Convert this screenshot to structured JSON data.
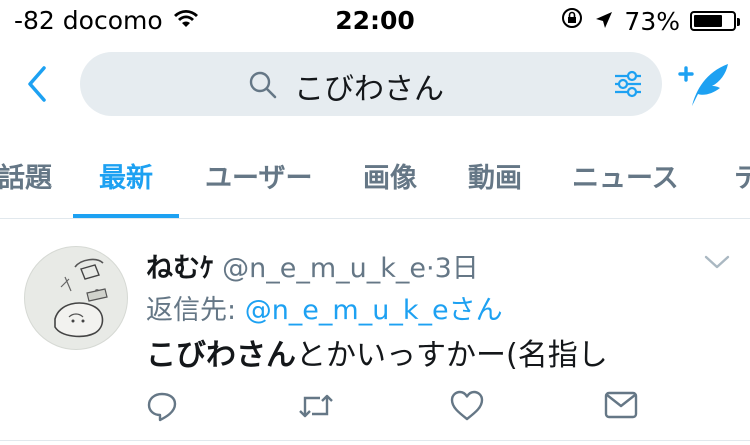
{
  "status_bar": {
    "carrier": "-82 docomo",
    "time": "22:00",
    "battery_percent": "73%",
    "battery_level": 0.73
  },
  "search": {
    "query": "こびわさん"
  },
  "tabs": [
    {
      "label": "話題"
    },
    {
      "label": "最新",
      "active": true
    },
    {
      "label": "ユーザー"
    },
    {
      "label": "画像"
    },
    {
      "label": "動画"
    },
    {
      "label": "ニュース"
    },
    {
      "label": "テ"
    }
  ],
  "tweet": {
    "display_name": "ねむｹ",
    "handle": "@n_e_m_u_k_e",
    "dot": "·",
    "time": "3日",
    "reply_prefix": "返信先: ",
    "reply_to": "@n_e_m_u_k_eさん",
    "body_bold": "こびわさん",
    "body_rest": "とかいっすかー(名指し"
  },
  "colors": {
    "accent": "#1da1f2",
    "muted": "#657786",
    "search_bg": "#e6ecf0",
    "divider": "#e1e8ed"
  },
  "icons": [
    "wifi-icon",
    "rotation-lock-icon",
    "location-arrow-icon",
    "battery-icon",
    "back-chevron-icon",
    "search-icon",
    "filter-sliders-icon",
    "compose-feather-icon",
    "chevron-down-icon",
    "reply-icon",
    "retweet-icon",
    "like-icon",
    "dm-icon"
  ]
}
